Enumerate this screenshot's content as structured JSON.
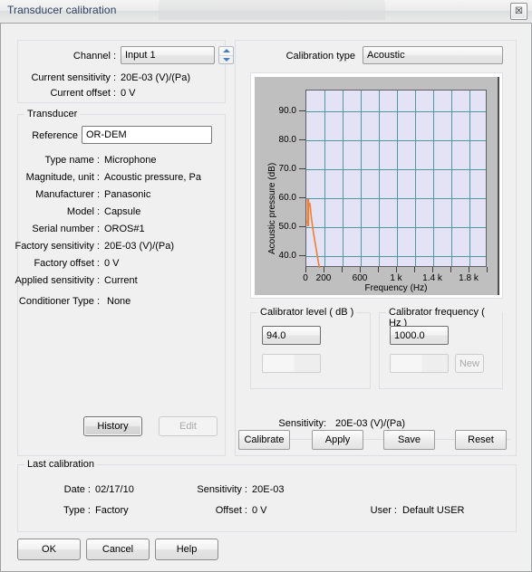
{
  "window": {
    "title": "Transducer calibration",
    "close_label": "☒"
  },
  "channel_panel": {
    "channel_label": "Channel :",
    "channel_value": "Input 1",
    "current_sensitivity_label": "Current sensitivity :",
    "current_sensitivity_value": "20E-03 (V)/(Pa)",
    "current_offset_label": "Current offset :",
    "current_offset_value": "0 V"
  },
  "transducer": {
    "legend": "Transducer",
    "reference_label": "Reference",
    "reference_value": "OR-DEM",
    "rows": [
      {
        "label": "Type name :",
        "value": "Microphone"
      },
      {
        "label": "Magnitude, unit :",
        "value": "Acoustic pressure, Pa"
      },
      {
        "label": "Manufacturer :",
        "value": "Panasonic"
      },
      {
        "label": "Model :",
        "value": "Capsule"
      },
      {
        "label": "Serial number :",
        "value": "OROS#1"
      },
      {
        "label": "Factory sensitivity :",
        "value": "20E-03 (V)/(Pa)"
      },
      {
        "label": "Factory offset :",
        "value": "0 V"
      },
      {
        "label": "Applied sensitivity :",
        "value": "Current"
      },
      {
        "label": "Conditioner Type :",
        "value": "None"
      }
    ],
    "history_button": "History",
    "edit_button": "Edit"
  },
  "calibration": {
    "type_label": "Calibration type",
    "type_value": "Acoustic",
    "calibrator_level_legend": "Calibrator level ( dB )",
    "calibrator_level_value": "94.0",
    "calibrator_level_second": "",
    "calibrator_frequency_legend": "Calibrator frequency ( Hz )",
    "calibrator_frequency_value": "1000.0",
    "calibrator_frequency_second": "",
    "new_button": "New",
    "sensitivity_label": "Sensitivity:",
    "sensitivity_value": "20E-03 (V)/(Pa)",
    "buttons": [
      "Calibrate",
      "Apply",
      "Save",
      "Reset"
    ]
  },
  "chart_data": {
    "type": "line",
    "title": "",
    "xlabel": "Frequency (Hz)",
    "ylabel": "Acoustic pressure (dB)",
    "xlim": [
      0,
      2000
    ],
    "ylim": [
      30,
      95
    ],
    "grid": true,
    "legend_position": "none",
    "y_ticks": [
      40.0,
      50.0,
      60.0,
      70.0,
      80.0,
      90.0
    ],
    "y_tick_labels": [
      "40.0",
      "50.0",
      "60.0",
      "70.0",
      "80.0",
      "90.0"
    ],
    "x_ticks": [
      0,
      200,
      400,
      600,
      800,
      1000,
      1200,
      1400,
      1600,
      1800,
      2000
    ],
    "x_tick_labels": [
      "0",
      "200",
      "",
      "600",
      "",
      "1 k",
      "",
      "1.4 k",
      "",
      "1.8 k",
      ""
    ],
    "series": [
      {
        "name": "Acoustic pressure",
        "color": "#f08030",
        "x": [
          10,
          25,
          40,
          55,
          70,
          85,
          100,
          115,
          130,
          145,
          155
        ],
        "y": [
          49.0,
          56.2,
          55.8,
          51.0,
          47.5,
          44.5,
          41.6,
          38.8,
          36.0,
          33.2,
          31.0
        ]
      }
    ]
  },
  "last_calibration": {
    "legend": "Last calibration",
    "date_label": "Date :",
    "date_value": "02/17/10",
    "sensitivity_label": "Sensitivity :",
    "sensitivity_value": "20E-03",
    "type_label": "Type :",
    "type_value": "Factory",
    "offset_label": "Offset :",
    "offset_value": "0 V",
    "user_label": "User :",
    "user_value": "Default USER"
  },
  "footer": {
    "ok": "OK",
    "cancel": "Cancel",
    "help": "Help"
  }
}
